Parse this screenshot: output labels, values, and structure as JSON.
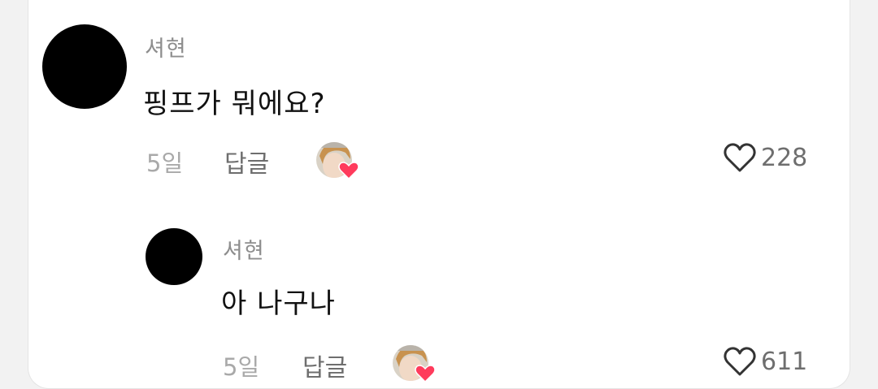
{
  "comments": [
    {
      "username": "셔현",
      "text": "핑프가 뭐에요?",
      "time": "5일",
      "reply_label": "답글",
      "like_count": "228"
    },
    {
      "username": "셔현",
      "text": "아 나구나",
      "time": "5일",
      "reply_label": "답글",
      "like_count": "611"
    }
  ],
  "icons": {
    "like": "heart-outline-icon",
    "creator_like": "creator-liked-avatar-icon"
  },
  "colors": {
    "text_primary": "#111111",
    "text_secondary": "#8e8e8e",
    "heart": "#ff3b5c"
  }
}
